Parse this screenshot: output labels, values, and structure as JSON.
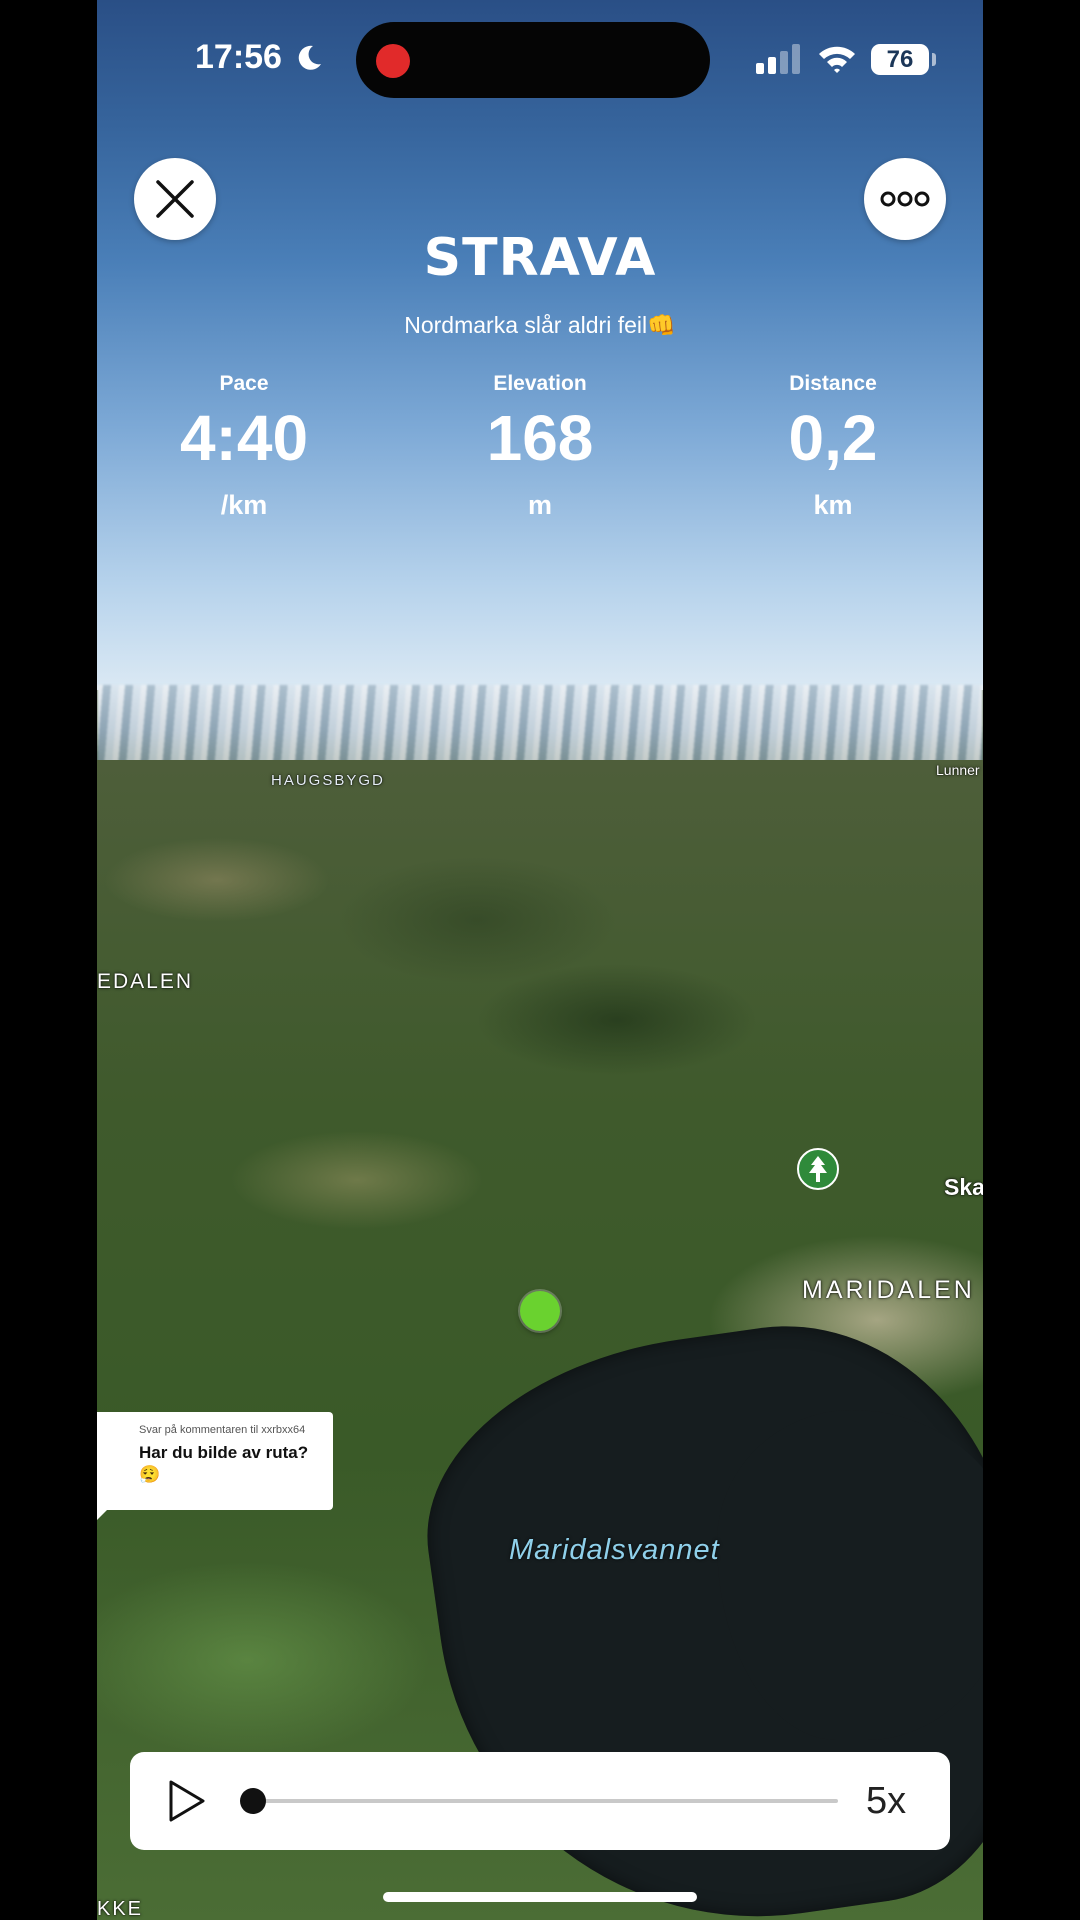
{
  "status_bar": {
    "time": "17:56",
    "battery": "76",
    "recording_color": "#e12a2a"
  },
  "header": {
    "logo": "STRAVA",
    "activity_title": "Nordmarka slår aldri feil👊"
  },
  "stats": [
    {
      "label": "Pace",
      "value": "4:40",
      "unit": "/km"
    },
    {
      "label": "Elevation",
      "value": "168",
      "unit": "m"
    },
    {
      "label": "Distance",
      "value": "0,2",
      "unit": "km"
    }
  ],
  "map": {
    "labels": {
      "haugsbygd": "HAUGSBYGD",
      "lunner": "Lunner",
      "edalen": "EDALEN",
      "ska": "Ska",
      "maridalen": "MARIDALEN",
      "kke": "KKE",
      "lake": "Maridalsvannet"
    },
    "position_marker_color": "#6ad22f",
    "poi_icon": "tree-icon"
  },
  "comment": {
    "reply_label": "Svar på kommentaren til xxrbxx64",
    "text": "Har du bilde av ruta?😮‍💨"
  },
  "playback": {
    "speed": "5x",
    "progress": 0.0
  }
}
